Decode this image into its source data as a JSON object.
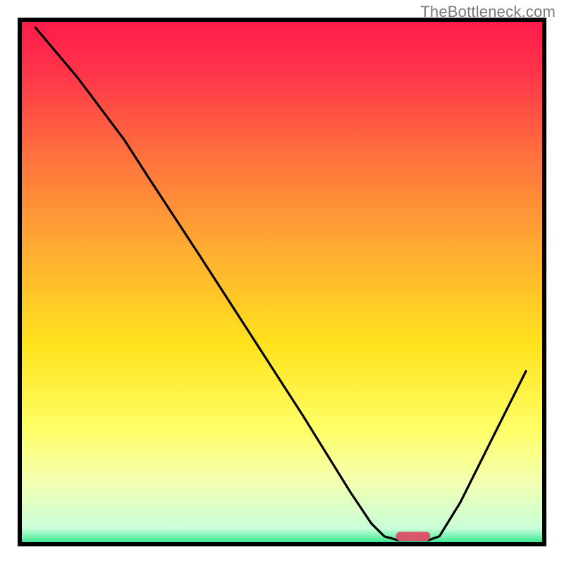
{
  "watermark": "TheBottleneck.com",
  "chart_data": {
    "type": "line",
    "title": "",
    "xlabel": "",
    "ylabel": "",
    "xlim": [
      0,
      100
    ],
    "ylim": [
      0,
      100
    ],
    "background_gradient": {
      "stops": [
        {
          "offset": 0.0,
          "color": "#ff1a4b"
        },
        {
          "offset": 0.1,
          "color": "#ff344a"
        },
        {
          "offset": 0.25,
          "color": "#ff6e3f"
        },
        {
          "offset": 0.45,
          "color": "#ffb030"
        },
        {
          "offset": 0.62,
          "color": "#ffe31c"
        },
        {
          "offset": 0.78,
          "color": "#ffff66"
        },
        {
          "offset": 0.88,
          "color": "#f4ffb0"
        },
        {
          "offset": 0.97,
          "color": "#c8ffd8"
        },
        {
          "offset": 1.0,
          "color": "#29e58a"
        }
      ]
    },
    "series": [
      {
        "name": "bottleneck-curve",
        "color": "#000000",
        "points": [
          {
            "x": 3.0,
            "y": 98.5
          },
          {
            "x": 11.0,
            "y": 89.0
          },
          {
            "x": 20.0,
            "y": 77.0
          },
          {
            "x": 24.5,
            "y": 70.0
          },
          {
            "x": 34.0,
            "y": 55.5
          },
          {
            "x": 44.0,
            "y": 40.0
          },
          {
            "x": 54.0,
            "y": 24.5
          },
          {
            "x": 63.0,
            "y": 10.0
          },
          {
            "x": 67.0,
            "y": 4.0
          },
          {
            "x": 69.5,
            "y": 1.5
          },
          {
            "x": 72.0,
            "y": 0.8
          },
          {
            "x": 78.0,
            "y": 0.8
          },
          {
            "x": 80.0,
            "y": 1.5
          },
          {
            "x": 84.0,
            "y": 8.0
          },
          {
            "x": 90.0,
            "y": 20.0
          },
          {
            "x": 96.5,
            "y": 33.0
          }
        ]
      }
    ],
    "marker": {
      "name": "optimum-indicator",
      "x": 75.0,
      "y": 1.5,
      "width": 6.5,
      "color": "#d9576a"
    },
    "frame": {
      "stroke": "#000000",
      "stroke_width": 6
    }
  }
}
